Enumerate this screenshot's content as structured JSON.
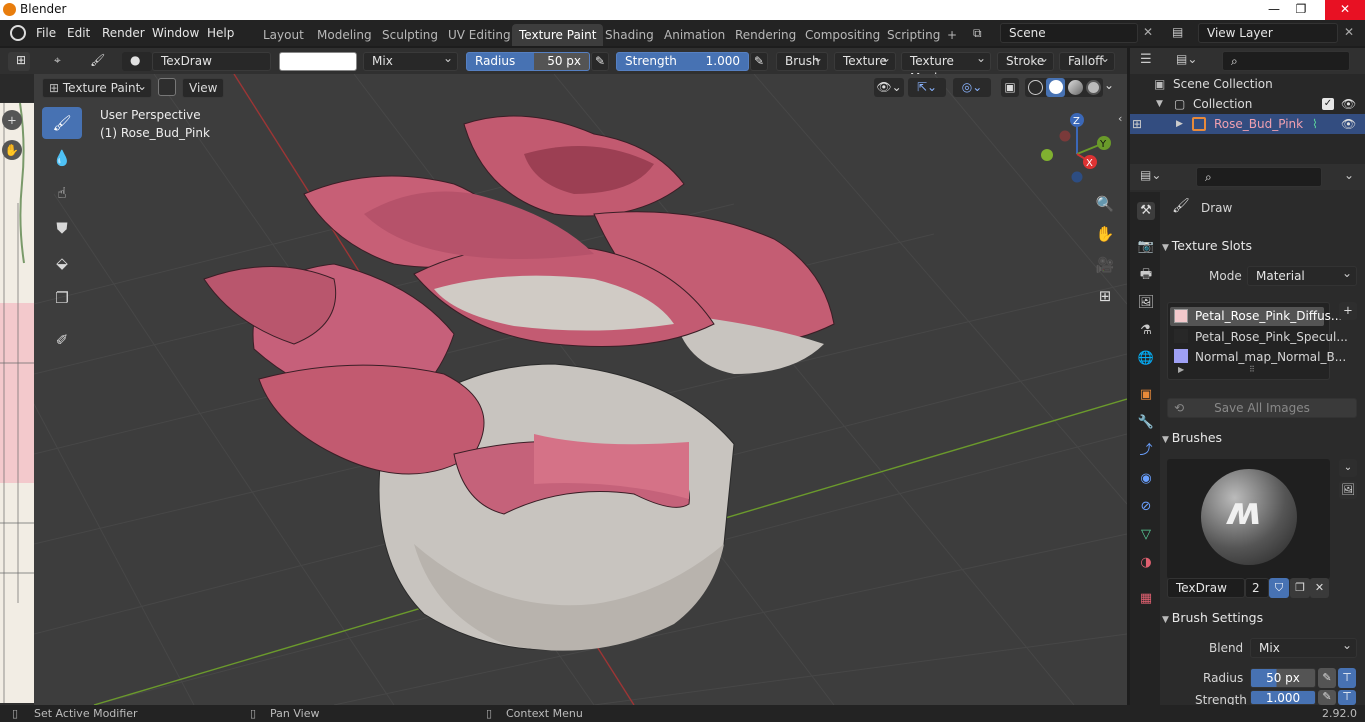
{
  "titlebar": {
    "title": "Blender",
    "minimize": "—",
    "maximize": "❐",
    "close": "✕"
  },
  "menu": {
    "items": [
      "File",
      "Edit",
      "Render",
      "Window",
      "Help"
    ]
  },
  "workspaces": {
    "tabs": [
      "Layout",
      "Modeling",
      "Sculpting",
      "UV Editing",
      "Texture Paint",
      "Shading",
      "Animation",
      "Rendering",
      "Compositing",
      "Scripting"
    ],
    "active": "Texture Paint",
    "add": "+"
  },
  "scene": {
    "name": "Scene",
    "view_layer": "View Layer"
  },
  "toolheader": {
    "brush_name": "TexDraw",
    "blend": "Mix",
    "radius_label": "Radius",
    "radius_value": "50 px",
    "strength_label": "Strength",
    "strength_value": "1.000",
    "menus": [
      "Brush",
      "Texture",
      "Texture Mask",
      "Stroke",
      "Falloff"
    ]
  },
  "viewport": {
    "mode": "Texture Paint",
    "view_menu": "View",
    "overlay_text_1": "User Perspective",
    "overlay_text_2": "(1) Rose_Bud_Pink",
    "gizmo": {
      "x": "X",
      "y": "Y",
      "z": "Z"
    },
    "colors": {
      "bg": "#3d3d3d",
      "grid": "#4a4a4a",
      "x_axis": "#b23b3b",
      "y_axis": "#6a9a2a",
      "petal": "#c25a6e",
      "white": "#c9c5c0"
    }
  },
  "outliner": {
    "scene_collection": "Scene Collection",
    "collection": "Collection",
    "object": "Rose_Bud_Pink"
  },
  "properties": {
    "tool_name": "Draw",
    "texture_slots": {
      "header": "Texture Slots",
      "mode_label": "Mode",
      "mode_value": "Material",
      "slots": [
        "Petal_Rose_Pink_Diffus...",
        "Petal_Rose_Pink_Specul...",
        "Normal_map_Normal_B..."
      ],
      "save_all": "Save All Images"
    },
    "brushes": {
      "header": "Brushes",
      "brush_name": "TexDraw",
      "users": "2"
    },
    "brush_settings": {
      "header": "Brush Settings",
      "blend_label": "Blend",
      "blend_value": "Mix",
      "radius_label": "Radius",
      "radius_value": "50 px",
      "strength_label": "Strength",
      "strength_value": "1.000"
    }
  },
  "statusbar": {
    "left": "Set Active Modifier",
    "middle": "Pan View",
    "right": "Context Menu",
    "version": "2.92.0"
  }
}
